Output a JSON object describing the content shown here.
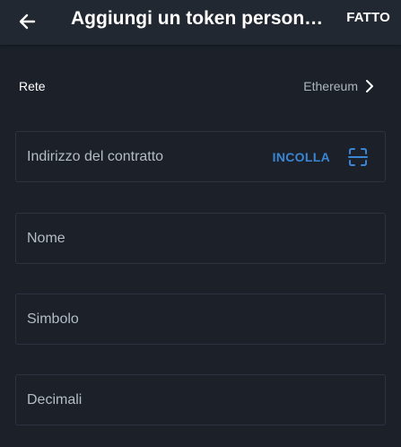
{
  "header": {
    "title": "Aggiungi un token personali…",
    "done_label": "FATTO"
  },
  "network": {
    "label": "Rete",
    "value": "Ethereum"
  },
  "fields": {
    "contract_address": {
      "placeholder": "Indirizzo del contratto",
      "value": ""
    },
    "paste_label": "INCOLLA",
    "name": {
      "placeholder": "Nome",
      "value": ""
    },
    "symbol": {
      "placeholder": "Simbolo",
      "value": ""
    },
    "decimals": {
      "placeholder": "Decimali",
      "value": ""
    }
  },
  "icons": {
    "back": "arrow-left-icon",
    "chevron": "chevron-right-icon",
    "scan": "qr-scan-icon"
  },
  "colors": {
    "background": "#1b2029",
    "appbar": "#222831",
    "accent": "#3a86d4",
    "muted_text": "#aeb6c1",
    "field_border": "#2c3340"
  }
}
